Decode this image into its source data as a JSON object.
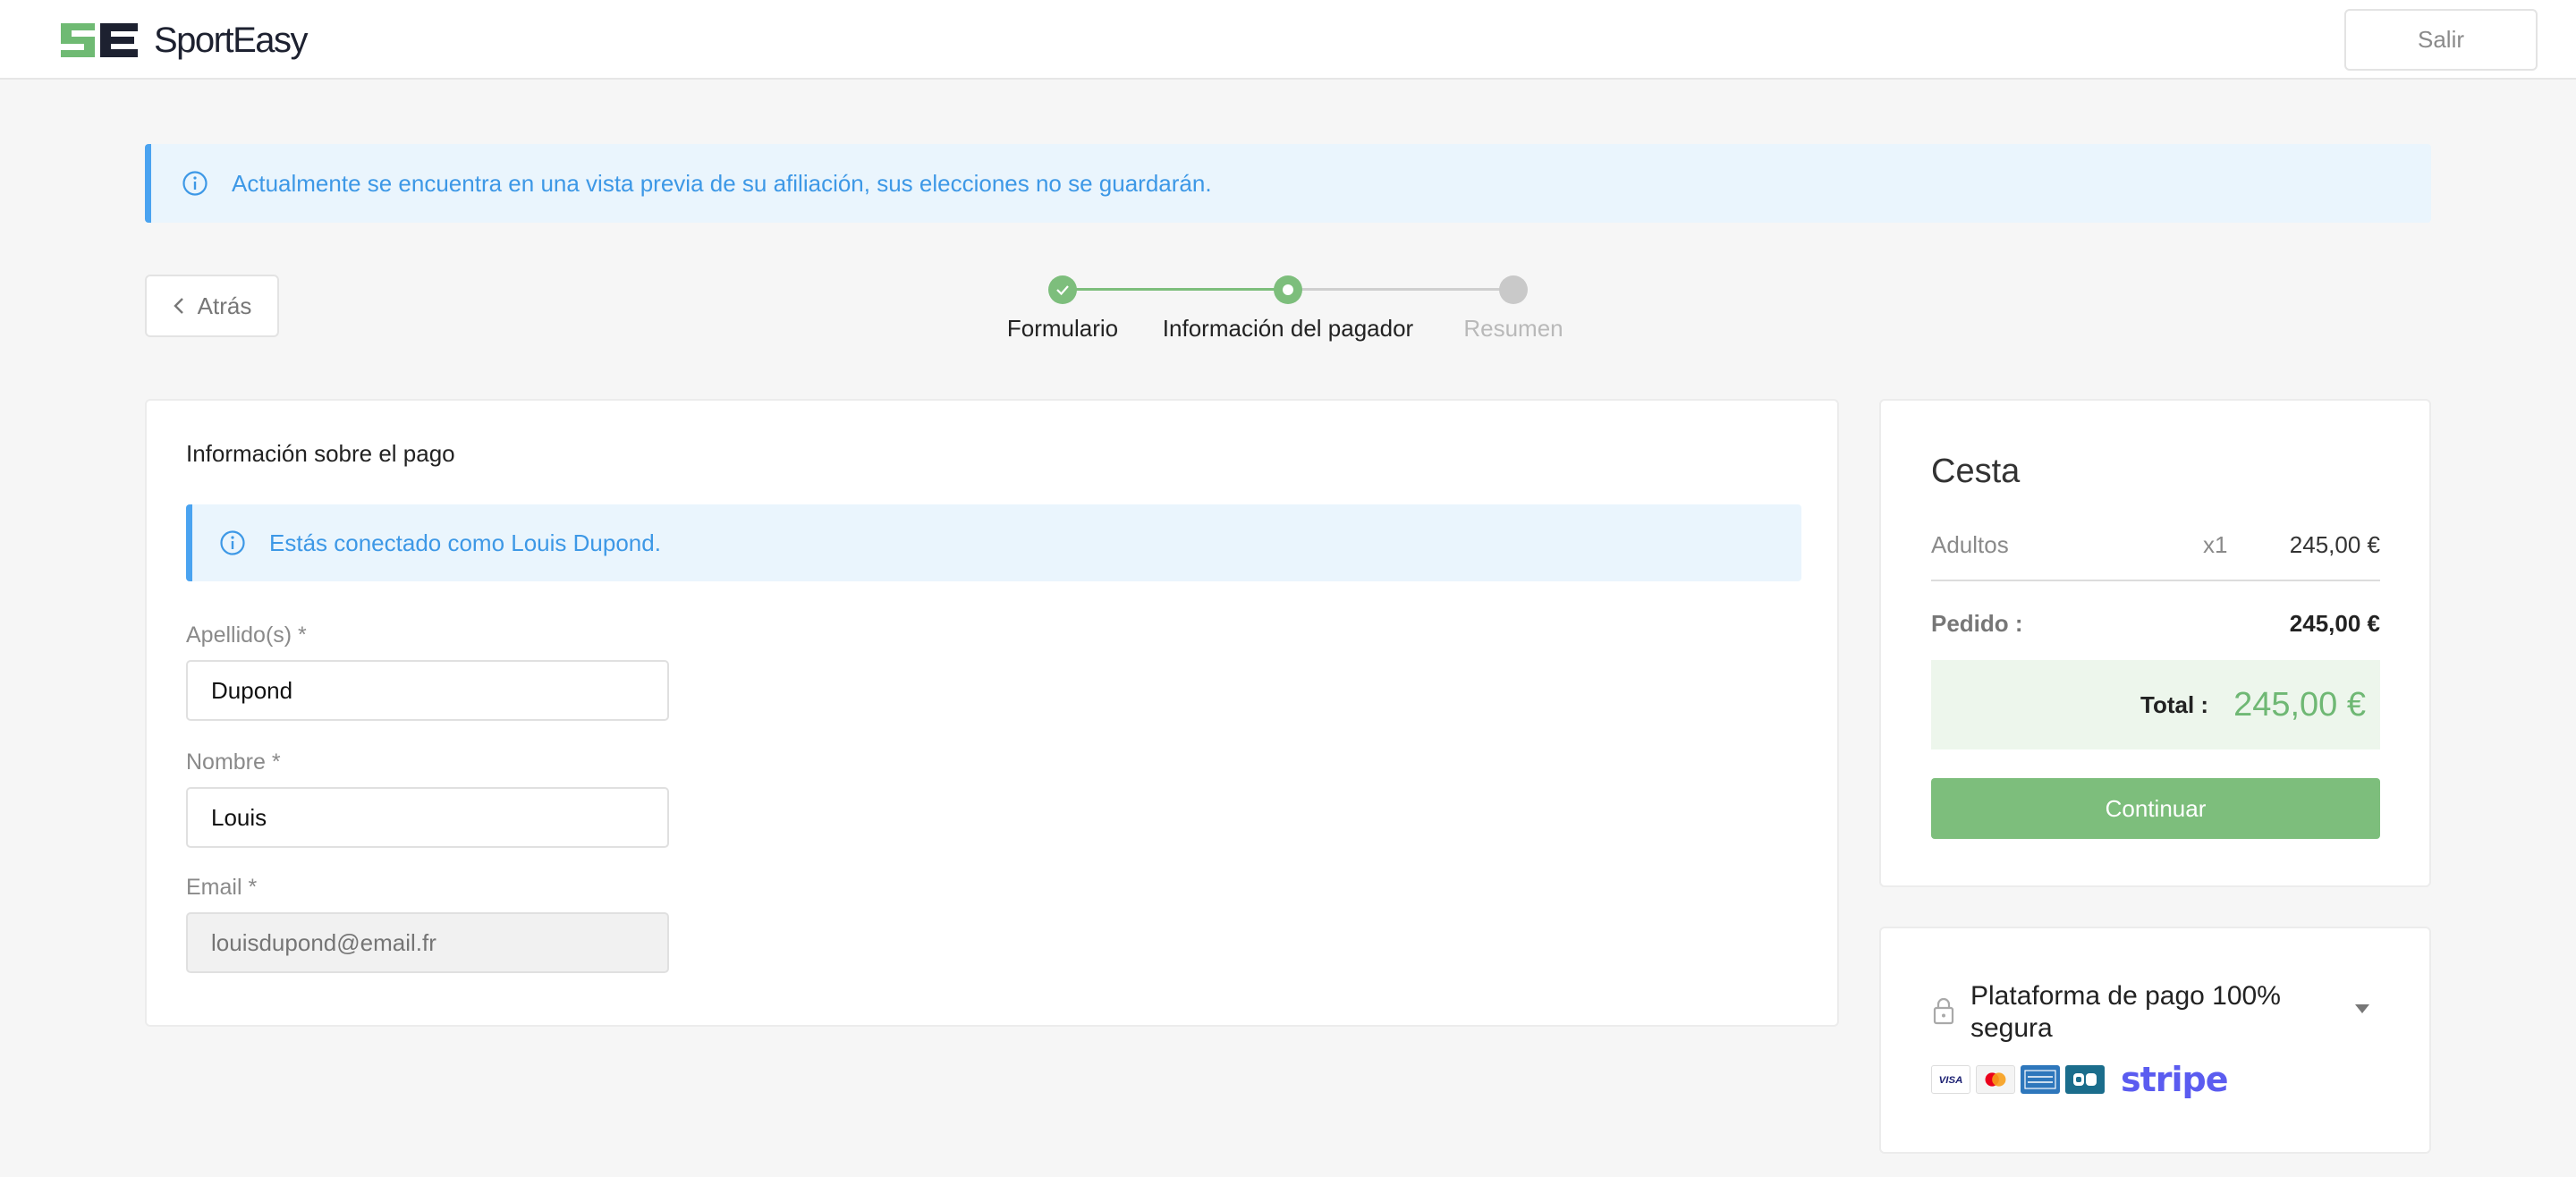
{
  "header": {
    "brand": "SportEasy",
    "logout_label": "Salir"
  },
  "preview_banner": {
    "text": "Actualmente se encuentra en una vista previa de su afiliación, sus elecciones no se guardarán."
  },
  "back_button": {
    "label": "Atrás"
  },
  "stepper": {
    "steps": [
      {
        "label": "Formulario",
        "state": "done"
      },
      {
        "label": "Información del pagador",
        "state": "current"
      },
      {
        "label": "Resumen",
        "state": "pending"
      }
    ]
  },
  "payment_form": {
    "title": "Información sobre el pago",
    "connected_text": "Estás conectado como Louis Dupond.",
    "fields": [
      {
        "label": "Apellido(s) *",
        "value": "Dupond"
      },
      {
        "label": "Nombre *",
        "value": "Louis"
      },
      {
        "label": "Email *",
        "placeholder": "louisdupond@email.fr"
      }
    ]
  },
  "basket": {
    "title": "Cesta",
    "item": {
      "name": "Adultos",
      "qty": "x1",
      "price": "245,00 €"
    },
    "order_label": "Pedido :",
    "order_value": "245,00 €",
    "total_label": "Total :",
    "total_value": "245,00 €",
    "continue_label": "Continuar"
  },
  "secure": {
    "title": "Plataforma de pago 100% segura",
    "card_brands": [
      "visa-icon",
      "mastercard-icon",
      "amex-icon",
      "cb-icon"
    ],
    "stripe": "stripe"
  },
  "colors": {
    "accent_green": "#7dbe7c",
    "info_blue": "#3d98e6",
    "info_bg": "#eaf5fd"
  }
}
